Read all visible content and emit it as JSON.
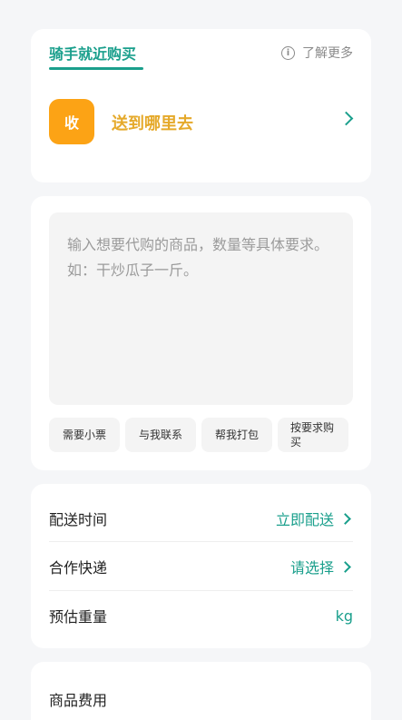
{
  "rider_card": {
    "tab_label": "骑手就近购买",
    "learn_more": "了解更多",
    "info_icon_glyph": "i",
    "receive_badge": "收",
    "destination_text": "送到哪里去"
  },
  "request_card": {
    "placeholder": "输入想要代购的商品，数量等具体要求。如：干炒瓜子一斤。",
    "chips": [
      "需要小票",
      "与我联系",
      "帮我打包",
      "按要求购买"
    ]
  },
  "options_card": {
    "rows": [
      {
        "label": "配送时间",
        "value": "立即配送"
      },
      {
        "label": "合作快递",
        "value": "请选择"
      },
      {
        "label": "预估重量",
        "value": "kg"
      }
    ]
  },
  "fee_card": {
    "label": "商品费用"
  },
  "colors": {
    "accent": "#1a9f8c",
    "badge": "#fca315",
    "destination": "#e5a92a",
    "background": "#f5f6f8"
  }
}
